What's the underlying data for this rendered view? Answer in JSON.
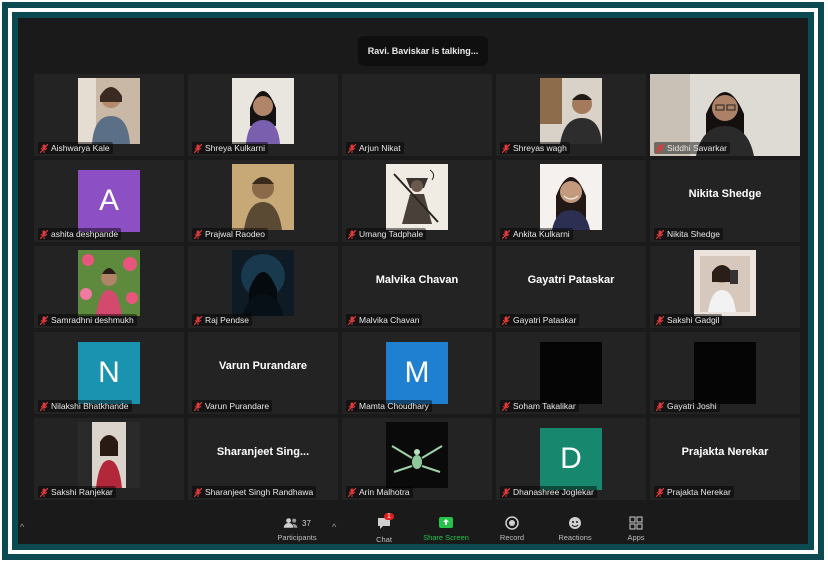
{
  "banner": {
    "talking": "Ravi. Baviskar is talking..."
  },
  "colors": {
    "frame": "#0c4a52",
    "background": "#1a1a1a",
    "tile": "#232323",
    "mic_muted": "#e03a3a",
    "share_green": "#27c24c",
    "chat_badge": "#e02020"
  },
  "tiles": [
    {
      "name": "Aishwarya Kale",
      "kind": "photo",
      "photo": "girl-light-room"
    },
    {
      "name": "Shreya Kulkarni",
      "kind": "photo",
      "photo": "girl-purple-top"
    },
    {
      "name": "Arjun Nikat",
      "kind": "empty"
    },
    {
      "name": "Shreyas wagh",
      "kind": "photo",
      "photo": "boy-window"
    },
    {
      "name": "Siddhi Savarkar",
      "kind": "photo-wide",
      "photo": "girl-glasses-white-wall"
    },
    {
      "name": "ashita deshpande",
      "kind": "letter",
      "letter": "A",
      "color": "#8d4fc4"
    },
    {
      "name": "Prajwal Raodeo",
      "kind": "photo",
      "photo": "boy-sepia"
    },
    {
      "name": "Umang Tadphale",
      "kind": "photo",
      "photo": "warrior-art"
    },
    {
      "name": "Ankita Kulkarni",
      "kind": "photo",
      "photo": "girl-smiling"
    },
    {
      "name": "Nikita Shedge",
      "kind": "name",
      "display": "Nikita Shedge"
    },
    {
      "name": "Samradhni deshmukh",
      "kind": "photo",
      "photo": "girl-flowers"
    },
    {
      "name": "Raj Pendse",
      "kind": "photo",
      "photo": "hooded-figure"
    },
    {
      "name": "Malvika Chavan",
      "kind": "name",
      "display": "Malvika Chavan"
    },
    {
      "name": "Gayatri Pataskar",
      "kind": "name",
      "display": "Gayatri Pataskar"
    },
    {
      "name": "Sakshi Gadgil",
      "kind": "photo",
      "photo": "girl-mirror-selfie"
    },
    {
      "name": "Nilakshi Bhatkhande",
      "kind": "letter",
      "letter": "N",
      "color": "#1a93b1"
    },
    {
      "name": "Varun Purandare",
      "kind": "name",
      "display": "Varun Purandare"
    },
    {
      "name": "Mamta Choudhary",
      "kind": "letter",
      "letter": "M",
      "color": "#1f7fd0"
    },
    {
      "name": "Soham Takalikar",
      "kind": "black"
    },
    {
      "name": "Gayatri Joshi",
      "kind": "black"
    },
    {
      "name": "Sakshi Ranjekar",
      "kind": "photo",
      "photo": "girl-red-dress"
    },
    {
      "name": "Sharanjeet Singh Randhawa",
      "kind": "name",
      "display": "Sharanjeet  Sing..."
    },
    {
      "name": "Arin Malhotra",
      "kind": "photo",
      "photo": "green-insect-logo"
    },
    {
      "name": "Dhanashree Joglekar",
      "kind": "letter",
      "letter": "D",
      "color": "#17876e"
    },
    {
      "name": "Prajakta Nerekar",
      "kind": "name",
      "display": "Prajakta Nerekar"
    }
  ],
  "toolbar": {
    "participants_count": "37",
    "participants": "Participants",
    "chat": "Chat",
    "chat_badge": "1",
    "share_screen": "Share Screen",
    "record": "Record",
    "reactions": "Reactions",
    "apps": "Apps"
  }
}
